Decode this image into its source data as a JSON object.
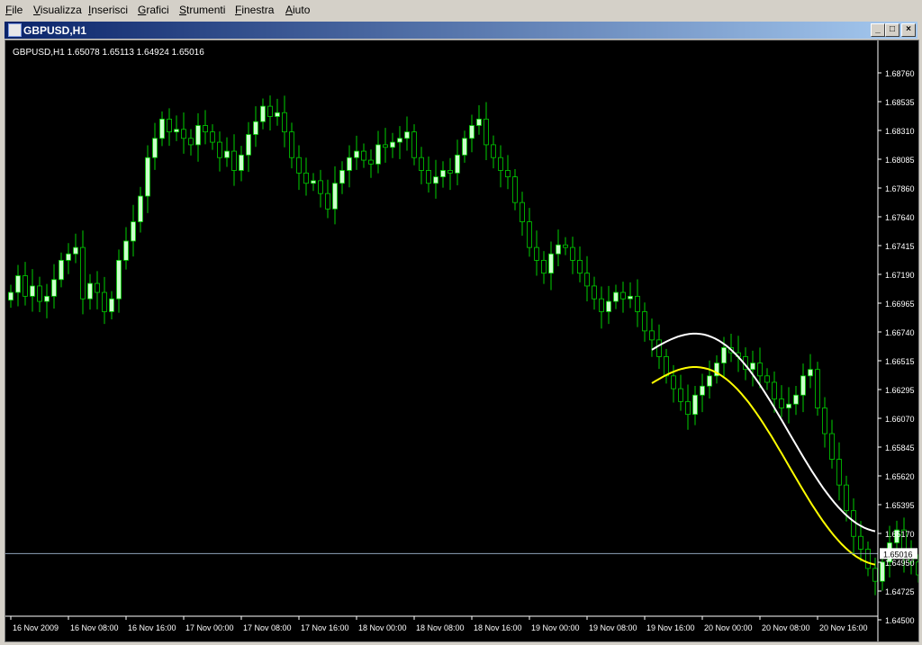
{
  "menu": {
    "items": [
      {
        "first": "F",
        "rest": "ile"
      },
      {
        "first": "V",
        "rest": "isualizza"
      },
      {
        "first": "I",
        "rest": "nserisci"
      },
      {
        "first": "G",
        "rest": "rafici"
      },
      {
        "first": "S",
        "rest": "trumenti"
      },
      {
        "first": "F",
        "rest": "inestra"
      },
      {
        "first": "A",
        "rest": "iuto"
      }
    ]
  },
  "window": {
    "title": "GBPUSD,H1",
    "minimize": "_",
    "restore": "□",
    "close": "×"
  },
  "chart": {
    "header": "GBPUSD,H1  1.65078 1.65113 1.64924 1.65016",
    "current_price": "1.65016",
    "colors": {
      "background": "#000000",
      "bull_body": "#ccffcc",
      "bear_body": "#000000",
      "wick": "#00d000",
      "upper_curve": "#ffffff",
      "lower_curve": "#ffff00",
      "price_line": "#8ea3b8"
    }
  },
  "chart_data": {
    "type": "candlestick",
    "symbol": "GBPUSD",
    "timeframe": "H1",
    "y_ticks": [
      "1.68760",
      "1.68535",
      "1.68310",
      "1.68085",
      "1.67860",
      "1.67640",
      "1.67415",
      "1.67190",
      "1.66965",
      "1.66740",
      "1.66515",
      "1.66295",
      "1.66070",
      "1.65845",
      "1.65620",
      "1.65395",
      "1.65170",
      "1.64950",
      "1.64725",
      "1.64500"
    ],
    "ylim": [
      1.645,
      1.6876
    ],
    "x_ticks": [
      "16 Nov 2009",
      "16 Nov 08:00",
      "16 Nov 16:00",
      "17 Nov 00:00",
      "17 Nov 08:00",
      "17 Nov 16:00",
      "18 Nov 00:00",
      "18 Nov 08:00",
      "18 Nov 16:00",
      "19 Nov 00:00",
      "19 Nov 08:00",
      "19 Nov 16:00",
      "20 Nov 00:00",
      "20 Nov 08:00",
      "20 Nov 16:00"
    ],
    "bars_per_tick": 8,
    "last_price": 1.65016,
    "closes": [
      1.6705,
      1.6718,
      1.6702,
      1.671,
      1.6698,
      1.6702,
      1.6715,
      1.673,
      1.6735,
      1.674,
      1.67,
      1.6712,
      1.6705,
      1.669,
      1.67,
      1.673,
      1.6745,
      1.676,
      1.678,
      1.681,
      1.6825,
      1.684,
      1.683,
      1.6832,
      1.6825,
      1.682,
      1.6835,
      1.683,
      1.6822,
      1.681,
      1.6815,
      1.68,
      1.6812,
      1.6828,
      1.6838,
      1.685,
      1.6842,
      1.6845,
      1.683,
      1.681,
      1.6798,
      1.679,
      1.6792,
      1.6782,
      1.677,
      1.679,
      1.68,
      1.681,
      1.6815,
      1.6808,
      1.6805,
      1.682,
      1.6818,
      1.6822,
      1.6825,
      1.683,
      1.681,
      1.68,
      1.679,
      1.6795,
      1.68,
      1.6798,
      1.6812,
      1.6825,
      1.6835,
      1.684,
      1.682,
      1.681,
      1.68,
      1.6795,
      1.6775,
      1.676,
      1.674,
      1.673,
      1.672,
      1.6735,
      1.6742,
      1.674,
      1.673,
      1.672,
      1.671,
      1.67,
      1.669,
      1.6698,
      1.6705,
      1.67,
      1.6702,
      1.669,
      1.6675,
      1.6668,
      1.6655,
      1.664,
      1.663,
      1.662,
      1.661,
      1.6625,
      1.6632,
      1.664,
      1.665,
      1.6662,
      1.6658,
      1.6655,
      1.6645,
      1.665,
      1.664,
      1.6635,
      1.6622,
      1.6615,
      1.6618,
      1.6625,
      1.664,
      1.6645,
      1.6615,
      1.6595,
      1.6575,
      1.6555,
      1.6535,
      1.6515,
      1.6505,
      1.649,
      1.648,
      1.6495,
      1.651,
      1.652,
      1.65,
      1.6495,
      1.6485,
      1.6505,
      1.6495,
      1.6502
    ]
  }
}
